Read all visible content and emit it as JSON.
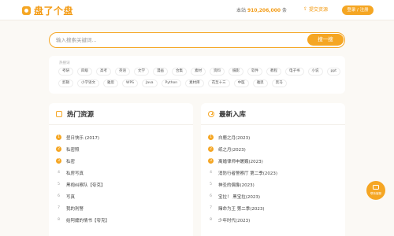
{
  "header": {
    "logo_text": "盘了个盘",
    "stats_prefix": "本站",
    "stats_count": "910,206,000",
    "stats_suffix": "条",
    "submit_label": "提交资源",
    "login_label": "登录 / 注册"
  },
  "search": {
    "placeholder": "输入搜索关键词...",
    "button_label": "搜一搜"
  },
  "hot_search": {
    "label": "热搜词",
    "row1": [
      "考研",
      "四级",
      "高考",
      "英语",
      "文学",
      "漫画",
      "合集",
      "素材",
      "资料",
      "摄影",
      "软件",
      "教程",
      "电子书",
      "小说",
      "ppt"
    ],
    "row2": [
      "剪辑",
      "小学语文",
      "雅思",
      "WPS",
      "Java",
      "Python",
      "素材库",
      "花至十三",
      "中医",
      "雅思",
      "黑马"
    ]
  },
  "panels": {
    "hot": {
      "title": "热门资源",
      "items": [
        "昼日快乐 (2017)",
        "私密照",
        "私密",
        "私房写真",
        "黑袍纠察队【夸克】",
        "写真",
        "我的刑警",
        "给阿嬷的情书【夸克】"
      ]
    },
    "new": {
      "title": "最新入库",
      "items": [
        "白鹿之月(2023)",
        "纸之月(2023)",
        "离婚律师申屠巍(2023)",
        "消防行者警察厅 第二季(2023)",
        "神圣的偶像(2023)",
        "宝拉！ 黑宝拉(2023)",
        "赌命为王 第二季(2023)",
        "少年时代(2023)"
      ]
    }
  },
  "float": {
    "label": "联系客服"
  },
  "colors": {
    "accent": "#f5a623",
    "background": "#fbf9f5"
  }
}
